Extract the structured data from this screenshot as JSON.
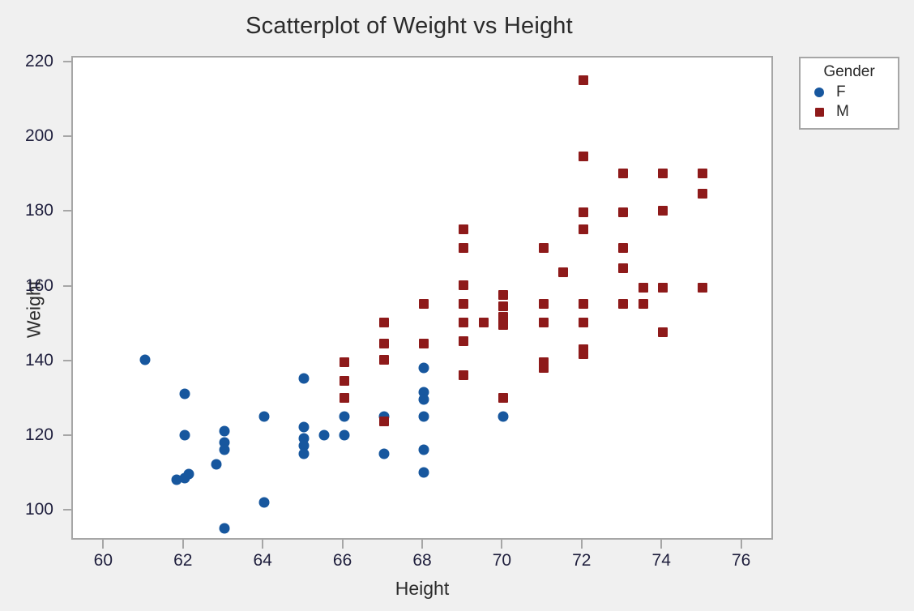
{
  "chart_data": {
    "type": "scatter",
    "title": "Scatterplot of Weight vs Height",
    "xlabel": "Height",
    "ylabel": "Weight",
    "xlim": [
      59.2,
      76.8
    ],
    "ylim": [
      92.0,
      221.5
    ],
    "xticks": [
      60,
      62,
      64,
      66,
      68,
      70,
      72,
      74,
      76
    ],
    "yticks": [
      100,
      120,
      140,
      160,
      180,
      200,
      220
    ],
    "grid": false,
    "legend": {
      "title": "Gender",
      "position": "right-top",
      "entries": [
        {
          "label": "F",
          "marker": "circle",
          "color": "#17579E"
        },
        {
          "label": "M",
          "marker": "square",
          "color": "#8E1A1A"
        }
      ]
    },
    "series": [
      {
        "name": "F",
        "marker": "circle",
        "color": "#17579E",
        "points": [
          [
            61.0,
            140.5
          ],
          [
            61.8,
            108.5
          ],
          [
            62.0,
            131.5
          ],
          [
            62.0,
            120.5
          ],
          [
            62.0,
            109.0
          ],
          [
            62.1,
            110.0
          ],
          [
            62.8,
            112.5
          ],
          [
            63.0,
            121.5
          ],
          [
            63.0,
            118.5
          ],
          [
            63.0,
            116.5
          ],
          [
            63.0,
            95.5
          ],
          [
            64.0,
            125.5
          ],
          [
            64.0,
            102.5
          ],
          [
            65.0,
            135.5
          ],
          [
            65.0,
            122.5
          ],
          [
            65.0,
            119.5
          ],
          [
            65.0,
            117.5
          ],
          [
            65.0,
            115.5
          ],
          [
            65.5,
            120.5
          ],
          [
            66.0,
            125.5
          ],
          [
            66.0,
            120.5
          ],
          [
            67.0,
            125.5
          ],
          [
            67.0,
            115.5
          ],
          [
            68.0,
            138.5
          ],
          [
            68.0,
            132.0
          ],
          [
            68.0,
            130.0
          ],
          [
            68.0,
            125.5
          ],
          [
            68.0,
            116.5
          ],
          [
            68.0,
            110.5
          ],
          [
            70.0,
            125.5
          ]
        ]
      },
      {
        "name": "M",
        "marker": "square",
        "color": "#8E1A1A",
        "points": [
          [
            66.0,
            140.0
          ],
          [
            66.0,
            135.0
          ],
          [
            66.0,
            130.5
          ],
          [
            67.0,
            150.5
          ],
          [
            67.0,
            145.0
          ],
          [
            67.0,
            140.5
          ],
          [
            67.0,
            124.0
          ],
          [
            68.0,
            155.5
          ],
          [
            68.0,
            145.0
          ],
          [
            69.0,
            175.5
          ],
          [
            69.0,
            170.5
          ],
          [
            69.0,
            160.5
          ],
          [
            69.0,
            155.5
          ],
          [
            69.0,
            150.5
          ],
          [
            69.0,
            145.5
          ],
          [
            69.0,
            136.5
          ],
          [
            69.5,
            150.5
          ],
          [
            70.0,
            158.0
          ],
          [
            70.0,
            155.0
          ],
          [
            70.0,
            152.0
          ],
          [
            70.0,
            150.0
          ],
          [
            70.0,
            130.5
          ],
          [
            71.0,
            170.5
          ],
          [
            71.0,
            155.5
          ],
          [
            71.0,
            150.5
          ],
          [
            71.0,
            140.0
          ],
          [
            71.0,
            138.5
          ],
          [
            71.5,
            164.0
          ],
          [
            72.0,
            215.5
          ],
          [
            72.0,
            195.0
          ],
          [
            72.0,
            180.0
          ],
          [
            72.0,
            175.5
          ],
          [
            72.0,
            155.5
          ],
          [
            72.0,
            150.5
          ],
          [
            72.0,
            143.5
          ],
          [
            72.0,
            142.0
          ],
          [
            73.0,
            190.5
          ],
          [
            73.0,
            180.0
          ],
          [
            73.0,
            170.5
          ],
          [
            73.0,
            165.0
          ],
          [
            73.0,
            155.5
          ],
          [
            73.5,
            155.5
          ],
          [
            73.5,
            160.0
          ],
          [
            74.0,
            190.5
          ],
          [
            74.0,
            180.5
          ],
          [
            74.0,
            160.0
          ],
          [
            74.0,
            148.0
          ],
          [
            75.0,
            190.5
          ],
          [
            75.0,
            185.0
          ],
          [
            75.0,
            160.0
          ]
        ]
      }
    ]
  },
  "colors": {
    "background": "#f0f0f0",
    "plot_background": "#ffffff",
    "frame": "#a6a6a6",
    "title_text": "#2b2b2b",
    "tick_text": "#1f1f3d",
    "female": "#17579E",
    "male": "#8E1A1A"
  }
}
